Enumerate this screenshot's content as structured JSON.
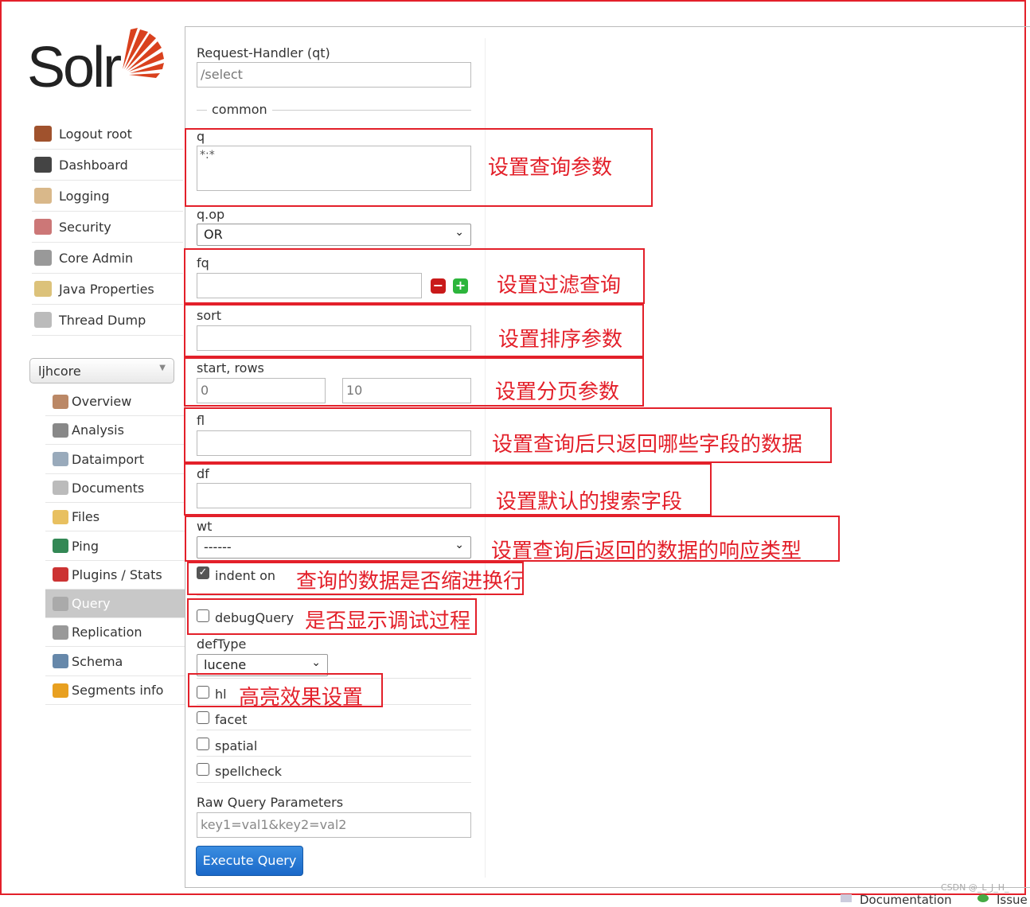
{
  "logo": {
    "text": "Solr"
  },
  "nav": [
    {
      "label": "Logout root",
      "icon": "door-icon"
    },
    {
      "label": "Dashboard",
      "icon": "gauge-icon"
    },
    {
      "label": "Logging",
      "icon": "inbox-icon"
    },
    {
      "label": "Security",
      "icon": "users-icon"
    },
    {
      "label": "Core Admin",
      "icon": "server-icon"
    },
    {
      "label": "Java Properties",
      "icon": "jar-icon"
    },
    {
      "label": "Thread Dump",
      "icon": "stack-icon"
    }
  ],
  "core_selector": {
    "value": "ljhcore"
  },
  "core_nav": [
    {
      "label": "Overview",
      "icon": "house-icon"
    },
    {
      "label": "Analysis",
      "icon": "funnel-icon"
    },
    {
      "label": "Dataimport",
      "icon": "import-icon"
    },
    {
      "label": "Documents",
      "icon": "documents-icon"
    },
    {
      "label": "Files",
      "icon": "folder-icon"
    },
    {
      "label": "Ping",
      "icon": "monitor-icon"
    },
    {
      "label": "Plugins / Stats",
      "icon": "blocks-icon"
    },
    {
      "label": "Query",
      "icon": "magnifier-icon",
      "active": true
    },
    {
      "label": "Replication",
      "icon": "replication-icon"
    },
    {
      "label": "Schema",
      "icon": "book-icon"
    },
    {
      "label": "Segments info",
      "icon": "barrier-icon"
    }
  ],
  "form": {
    "qt_label": "Request-Handler (qt)",
    "qt_value": "/select",
    "common_legend": "common",
    "q_label": "q",
    "q_value": "*:*",
    "qop_label": "q.op",
    "qop_value": "OR",
    "fq_label": "fq",
    "fq_value": "",
    "sort_label": "sort",
    "sort_value": "",
    "start_rows_label": "start, rows",
    "start_value": "0",
    "rows_value": "10",
    "fl_label": "fl",
    "fl_value": "",
    "df_label": "df",
    "df_value": "",
    "wt_label": "wt",
    "wt_value": "------",
    "indent_label": "indent on",
    "indent_checked": true,
    "debug_label": "debugQuery",
    "debug_checked": false,
    "deftype_label": "defType",
    "deftype_value": "lucene",
    "hl_label": "hl",
    "facet_label": "facet",
    "spatial_label": "spatial",
    "spellcheck_label": "spellcheck",
    "raw_label": "Raw Query Parameters",
    "raw_placeholder": "key1=val1&key2=val2",
    "execute_label": "Execute Query"
  },
  "annotations": {
    "q": "设置查询参数",
    "fq": "设置过滤查询",
    "sort": "设置排序参数",
    "paging": "设置分页参数",
    "fl": "设置查询后只返回哪些字段的数据",
    "df": "设置默认的搜索字段",
    "wt": "设置查询后返回的数据的响应类型",
    "indent": "查询的数据是否缩进换行",
    "debug": "是否显示调试过程",
    "hl": "高亮效果设置"
  },
  "footer": {
    "documentation": "Documentation",
    "issues": "Issue",
    "watermark": "CSDN @_L_J_H_"
  },
  "colors": {
    "annotation": "#e3202a",
    "logo": "#d9411e",
    "button": "#1a68c8"
  }
}
